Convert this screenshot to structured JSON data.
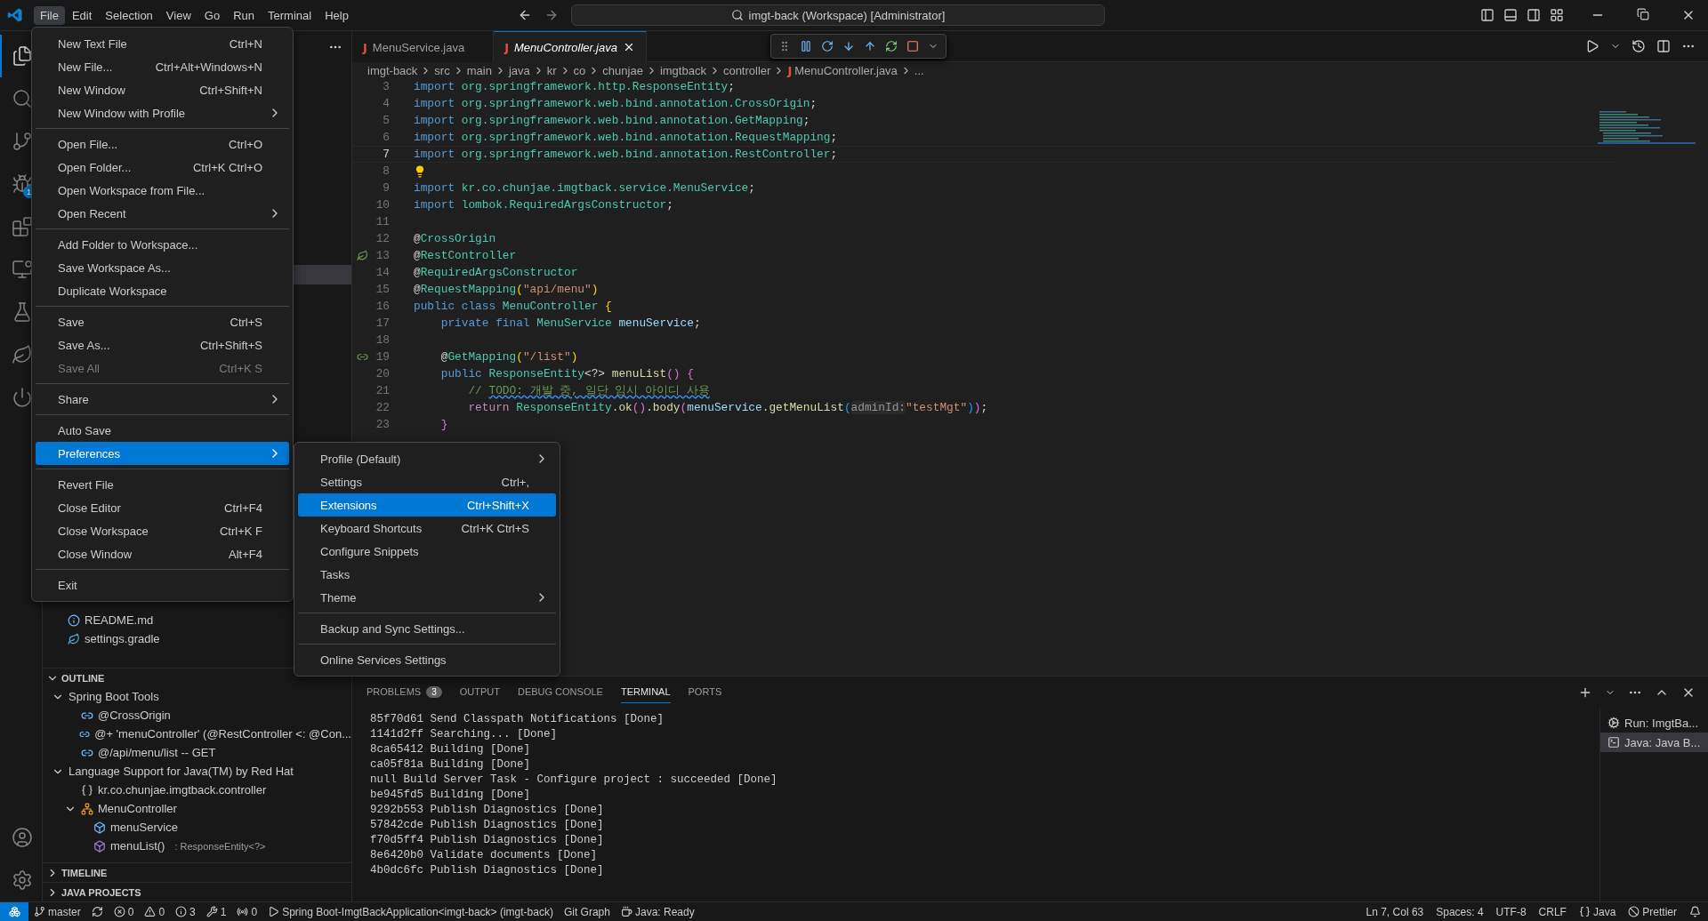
{
  "title_bar": {
    "menus": [
      {
        "label": "File",
        "selected": true
      },
      {
        "label": "Edit",
        "selected": false
      },
      {
        "label": "Selection",
        "selected": false
      },
      {
        "label": "View",
        "selected": false
      },
      {
        "label": "Go",
        "selected": false
      },
      {
        "label": "Run",
        "selected": false
      },
      {
        "label": "Terminal",
        "selected": false
      },
      {
        "label": "Help",
        "selected": false
      }
    ],
    "search": "imgt-back (Workspace) [Administrator]"
  },
  "activity_bar": {
    "items": [
      {
        "kind": "explorer",
        "selected": true
      },
      {
        "kind": "search",
        "selected": false
      },
      {
        "kind": "source-control",
        "selected": false
      },
      {
        "kind": "run-debug",
        "selected": false,
        "badge": "1"
      },
      {
        "kind": "extensions",
        "selected": false
      },
      {
        "kind": "remote",
        "selected": false
      },
      {
        "kind": "testing",
        "selected": false
      },
      {
        "kind": "gradle",
        "selected": false
      },
      {
        "kind": "spring",
        "selected": false
      }
    ],
    "bottom": [
      {
        "kind": "account"
      },
      {
        "kind": "settings"
      }
    ]
  },
  "sidebar": {
    "files": [
      {
        "name": "README.md",
        "kind": "info"
      },
      {
        "name": "settings.gradle",
        "kind": "gradle"
      }
    ],
    "outline": {
      "title": "OUTLINE",
      "expanded": true,
      "items": [
        {
          "label": "Spring Boot Tools",
          "expanded": true,
          "children": [
            {
              "label": "@CrossOrigin",
              "kind": "annotation"
            },
            {
              "label": "@+ 'menuController' (@RestController <: @Con...",
              "kind": "annotation"
            },
            {
              "label": "@/api/menu/list -- GET",
              "kind": "annotation"
            }
          ]
        },
        {
          "label": "Language Support for Java(TM) by Red Hat",
          "expanded": true,
          "children": [
            {
              "label": "kr.co.chunjae.imgtback.controller",
              "kind": "package"
            },
            {
              "label": "MenuController",
              "kind": "class",
              "expanded": true,
              "children": [
                {
                  "label": "menuService",
                  "kind": "field"
                },
                {
                  "label": "menuList()",
                  "kind": "method",
                  "detail": ": ResponseEntity<?>"
                }
              ]
            }
          ]
        }
      ]
    },
    "sections": [
      {
        "title": "TIMELINE",
        "expanded": false
      },
      {
        "title": "JAVA PROJECTS",
        "expanded": false
      }
    ]
  },
  "editor": {
    "tabs": [
      {
        "icon": "J",
        "label": "MenuService.java",
        "selected": false
      },
      {
        "icon": "J",
        "label": "MenuController.java",
        "selected": true
      }
    ],
    "breadcrumbs": [
      {
        "label": "imgt-back"
      },
      {
        "label": "src"
      },
      {
        "label": "main"
      },
      {
        "label": "java"
      },
      {
        "label": "kr"
      },
      {
        "label": "co"
      },
      {
        "label": "chunjae"
      },
      {
        "label": "imgtback"
      },
      {
        "label": "controller"
      },
      {
        "icon": "J",
        "label": "MenuController.java"
      },
      {
        "label": "..."
      }
    ],
    "lines": [
      {
        "n": "3",
        "current": false,
        "tokens": [
          {
            "text": "import ",
            "kind": "kw"
          },
          {
            "text": "org.springframework.http.ResponseEntity",
            "kind": "type"
          },
          {
            "text": ";",
            "kind": "plain"
          }
        ]
      },
      {
        "n": "4",
        "current": false,
        "tokens": [
          {
            "text": "import ",
            "kind": "kw"
          },
          {
            "text": "org.springframework.web.bind.annotation.CrossOrigin",
            "kind": "type"
          },
          {
            "text": ";",
            "kind": "plain"
          }
        ]
      },
      {
        "n": "5",
        "current": false,
        "tokens": [
          {
            "text": "import ",
            "kind": "kw"
          },
          {
            "text": "org.springframework.web.bind.annotation.GetMapping",
            "kind": "type"
          },
          {
            "text": ";",
            "kind": "plain"
          }
        ]
      },
      {
        "n": "6",
        "current": false,
        "tokens": [
          {
            "text": "import ",
            "kind": "kw"
          },
          {
            "text": "org.springframework.web.bind.annotation.RequestMapping",
            "kind": "type"
          },
          {
            "text": ";",
            "kind": "plain"
          }
        ]
      },
      {
        "n": "7",
        "current": true,
        "tokens": [
          {
            "text": "import ",
            "kind": "kw"
          },
          {
            "text": "org.springframework.web.bind.annotation.RestController",
            "kind": "type"
          },
          {
            "text": ";",
            "kind": "plain"
          }
        ]
      },
      {
        "n": "8",
        "current": false,
        "kind": "lightbulb"
      },
      {
        "n": "9",
        "current": false,
        "tokens": [
          {
            "text": "import ",
            "kind": "kw"
          },
          {
            "text": "kr.co.chunjae.imgtback.service.MenuService",
            "kind": "type"
          },
          {
            "text": ";",
            "kind": "plain"
          }
        ]
      },
      {
        "n": "10",
        "current": false,
        "tokens": [
          {
            "text": "import ",
            "kind": "kw"
          },
          {
            "text": "lombok.RequiredArgsConstructor",
            "kind": "type"
          },
          {
            "text": ";",
            "kind": "plain"
          }
        ]
      },
      {
        "n": "11",
        "current": false
      },
      {
        "n": "12",
        "current": false,
        "tokens": [
          {
            "text": "@",
            "kind": "plain"
          },
          {
            "text": "CrossOrigin",
            "kind": "type"
          }
        ]
      },
      {
        "n": "13",
        "current": false,
        "kind": "bean",
        "tokens": [
          {
            "text": "@",
            "kind": "plain"
          },
          {
            "text": "RestController",
            "kind": "type"
          }
        ]
      },
      {
        "n": "14",
        "current": false,
        "tokens": [
          {
            "text": "@",
            "kind": "plain"
          },
          {
            "text": "RequiredArgsConstructor",
            "kind": "type"
          }
        ]
      },
      {
        "n": "15",
        "current": false,
        "tokens": [
          {
            "text": "@",
            "kind": "plain"
          },
          {
            "text": "RequestMapping",
            "kind": "type"
          },
          {
            "text": "(",
            "kind": "b1"
          },
          {
            "text": "\"api/menu\"",
            "kind": "str"
          },
          {
            "text": ")",
            "kind": "b1"
          }
        ]
      },
      {
        "n": "16",
        "current": false,
        "tokens": [
          {
            "text": "public class ",
            "kind": "kw"
          },
          {
            "text": "MenuController ",
            "kind": "type"
          },
          {
            "text": "{",
            "kind": "b1"
          }
        ]
      },
      {
        "n": "17",
        "current": false,
        "tokens": [
          {
            "text": "    private final ",
            "kind": "kw"
          },
          {
            "text": "MenuService ",
            "kind": "type"
          },
          {
            "text": "menuService",
            "kind": "var"
          },
          {
            "text": ";",
            "kind": "plain"
          }
        ]
      },
      {
        "n": "18",
        "current": false
      },
      {
        "n": "19",
        "current": false,
        "kind": "mapping",
        "tokens": [
          {
            "text": "    @",
            "kind": "plain"
          },
          {
            "text": "GetMapping",
            "kind": "type"
          },
          {
            "text": "(",
            "kind": "b1"
          },
          {
            "text": "\"/list\"",
            "kind": "str"
          },
          {
            "text": ")",
            "kind": "b1"
          }
        ]
      },
      {
        "n": "20",
        "current": false,
        "tokens": [
          {
            "text": "    public ",
            "kind": "kw"
          },
          {
            "text": "ResponseEntity",
            "kind": "type"
          },
          {
            "text": "<?> ",
            "kind": "plain"
          },
          {
            "text": "menuList",
            "kind": "fn"
          },
          {
            "text": "() {",
            "kind": "b2"
          }
        ]
      },
      {
        "n": "21",
        "current": false,
        "tokens": [
          {
            "text": "        // ",
            "kind": "comment"
          },
          {
            "text": "TODO: 개발 중, 일단 임시 아이디 사용",
            "kind": "todo"
          }
        ]
      },
      {
        "n": "22",
        "current": false,
        "tokens": [
          {
            "text": "        return ",
            "kind": "ctrl"
          },
          {
            "text": "ResponseEntity",
            "kind": "type"
          },
          {
            "text": ".",
            "kind": "plain"
          },
          {
            "text": "ok",
            "kind": "fn"
          },
          {
            "text": "()",
            "kind": "b2"
          },
          {
            "text": ".",
            "kind": "plain"
          },
          {
            "text": "body",
            "kind": "fn"
          },
          {
            "text": "(",
            "kind": "b2"
          },
          {
            "text": "menuService",
            "kind": "var"
          },
          {
            "text": ".",
            "kind": "plain"
          },
          {
            "text": "getMenuList",
            "kind": "fn"
          },
          {
            "text": "(",
            "kind": "b3"
          },
          {
            "text": "adminId:",
            "kind": "hint"
          },
          {
            "text": "\"testMgt\"",
            "kind": "str"
          },
          {
            "text": ")",
            "kind": "b3"
          },
          {
            "text": ")",
            "kind": "b2"
          },
          {
            "text": ";",
            "kind": "plain"
          }
        ]
      },
      {
        "n": "23",
        "current": false,
        "tokens": [
          {
            "text": "    }",
            "kind": "b2"
          }
        ]
      }
    ]
  },
  "file_menu": {
    "groups": [
      [
        {
          "label": "New Text File",
          "shortcut": "Ctrl+N",
          "submenu": false,
          "disabled": false,
          "selected": false
        },
        {
          "label": "New File...",
          "shortcut": "Ctrl+Alt+Windows+N",
          "submenu": false,
          "disabled": false,
          "selected": false
        },
        {
          "label": "New Window",
          "shortcut": "Ctrl+Shift+N",
          "submenu": false,
          "disabled": false,
          "selected": false
        },
        {
          "label": "New Window with Profile",
          "submenu": true,
          "disabled": false,
          "selected": false
        }
      ],
      [
        {
          "label": "Open File...",
          "shortcut": "Ctrl+O",
          "submenu": false,
          "disabled": false,
          "selected": false
        },
        {
          "label": "Open Folder...",
          "shortcut": "Ctrl+K Ctrl+O",
          "submenu": false,
          "disabled": false,
          "selected": false
        },
        {
          "label": "Open Workspace from File...",
          "submenu": false,
          "disabled": false,
          "selected": false
        },
        {
          "label": "Open Recent",
          "submenu": true,
          "disabled": false,
          "selected": false
        }
      ],
      [
        {
          "label": "Add Folder to Workspace...",
          "submenu": false,
          "disabled": false,
          "selected": false
        },
        {
          "label": "Save Workspace As...",
          "submenu": false,
          "disabled": false,
          "selected": false
        },
        {
          "label": "Duplicate Workspace",
          "submenu": false,
          "disabled": false,
          "selected": false
        }
      ],
      [
        {
          "label": "Save",
          "shortcut": "Ctrl+S",
          "submenu": false,
          "disabled": false,
          "selected": false
        },
        {
          "label": "Save As...",
          "shortcut": "Ctrl+Shift+S",
          "submenu": false,
          "disabled": false,
          "selected": false
        },
        {
          "label": "Save All",
          "shortcut": "Ctrl+K S",
          "submenu": false,
          "disabled": true,
          "selected": false
        }
      ],
      [
        {
          "label": "Share",
          "submenu": true,
          "disabled": false,
          "selected": false
        }
      ],
      [
        {
          "label": "Auto Save",
          "submenu": false,
          "disabled": false,
          "selected": false
        },
        {
          "label": "Preferences",
          "submenu": true,
          "disabled": false,
          "selected": true
        }
      ],
      [
        {
          "label": "Revert File",
          "submenu": false,
          "disabled": false,
          "selected": false
        },
        {
          "label": "Close Editor",
          "shortcut": "Ctrl+F4",
          "submenu": false,
          "disabled": false,
          "selected": false
        },
        {
          "label": "Close Workspace",
          "shortcut": "Ctrl+K F",
          "submenu": false,
          "disabled": false,
          "selected": false
        },
        {
          "label": "Close Window",
          "shortcut": "Alt+F4",
          "submenu": false,
          "disabled": false,
          "selected": false
        }
      ],
      [
        {
          "label": "Exit",
          "submenu": false,
          "disabled": false,
          "selected": false
        }
      ]
    ]
  },
  "preferences_submenu": {
    "groups": [
      [
        {
          "label": "Profile (Default)",
          "submenu": true,
          "disabled": false,
          "selected": false
        },
        {
          "label": "Settings",
          "shortcut": "Ctrl+,",
          "submenu": false,
          "disabled": false,
          "selected": false
        },
        {
          "label": "Extensions",
          "shortcut": "Ctrl+Shift+X",
          "submenu": false,
          "disabled": false,
          "selected": true
        },
        {
          "label": "Keyboard Shortcuts",
          "shortcut": "Ctrl+K Ctrl+S",
          "submenu": false,
          "disabled": false,
          "selected": false
        },
        {
          "label": "Configure Snippets",
          "submenu": false,
          "disabled": false,
          "selected": false
        },
        {
          "label": "Tasks",
          "submenu": false,
          "disabled": false,
          "selected": false
        },
        {
          "label": "Theme",
          "submenu": true,
          "disabled": false,
          "selected": false
        }
      ],
      [
        {
          "label": "Backup and Sync Settings...",
          "submenu": false,
          "disabled": false,
          "selected": false
        }
      ],
      [
        {
          "label": "Online Services Settings",
          "submenu": false,
          "disabled": false,
          "selected": false
        }
      ]
    ]
  },
  "panel": {
    "tabs": [
      {
        "label": "PROBLEMS",
        "selected": false,
        "badge": "3"
      },
      {
        "label": "OUTPUT",
        "selected": false
      },
      {
        "label": "DEBUG CONSOLE",
        "selected": false
      },
      {
        "label": "TERMINAL",
        "selected": true
      },
      {
        "label": "PORTS",
        "selected": false
      }
    ],
    "terminal_lines": [
      "85f70d61 Send Classpath Notifications [Done]",
      "1141d2ff Searching... [Done]",
      "8ca65412 Building [Done]",
      "ca05f81a Building [Done]",
      "null Build Server Task - Configure project : succeeded [Done]",
      "be945fd5 Building [Done]",
      "9292b553 Publish Diagnostics [Done]",
      "57842cde Publish Diagnostics [Done]",
      "f70d5ff4 Publish Diagnostics [Done]",
      "8e6420b0 Validate documents [Done]",
      "4b0dc6fc Publish Diagnostics [Done]"
    ],
    "terminals": [
      {
        "label": "Run: ImgtBa...",
        "kind": "gear",
        "selected": false
      },
      {
        "label": "Java: Java B...",
        "kind": "terminal",
        "selected": true
      }
    ]
  },
  "status_bar": {
    "left": [
      {
        "text": "master",
        "kind": "branch"
      },
      {
        "kind": "sync"
      },
      {
        "text": "0",
        "kind": "error"
      },
      {
        "text": "0",
        "kind": "warning"
      },
      {
        "text": "3",
        "kind": "info"
      },
      {
        "text": "1",
        "kind": "tools"
      },
      {
        "text": "0",
        "kind": "antenna"
      },
      {
        "text": "Spring Boot-ImgtBackApplication<imgt-back> (imgt-back)",
        "kind": "run"
      },
      {
        "text": "Git Graph",
        "kind": "none"
      },
      {
        "text": "Java: Ready",
        "kind": "coffee"
      }
    ],
    "right": [
      {
        "text": "Ln 7, Col 63",
        "kind": "none"
      },
      {
        "text": "Spaces: 4",
        "kind": "none"
      },
      {
        "text": "UTF-8",
        "kind": "none"
      },
      {
        "text": "CRLF",
        "kind": "none"
      },
      {
        "text": "Java",
        "kind": "braces"
      },
      {
        "text": "Prettier",
        "kind": "ban"
      },
      {
        "kind": "bell"
      }
    ]
  }
}
